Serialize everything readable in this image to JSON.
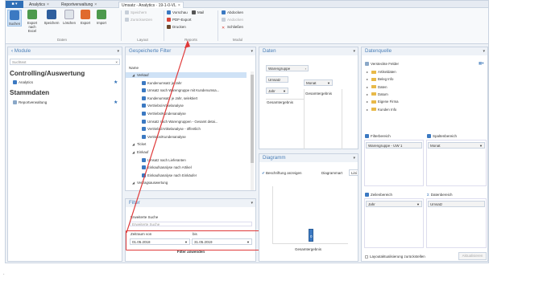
{
  "tabs": [
    {
      "label": "Analytics",
      "close": "×"
    },
    {
      "label": "Reportverwaltung",
      "close": "×"
    },
    {
      "label": "Umsatz - Analytics · 19-1-0-VL",
      "close": "×"
    }
  ],
  "ribbon": {
    "buttons": [
      {
        "label": "Suchen"
      },
      {
        "label": "Export nach Excel"
      },
      {
        "label": "Speichern"
      },
      {
        "label": "Löschen"
      },
      {
        "label": "Export"
      },
      {
        "label": "Import"
      }
    ],
    "daten_group": "Daten",
    "layout_items": [
      "Speichern",
      "Zurücksetzen"
    ],
    "layout_group": "Layout",
    "reports_items": [
      "Vorschau",
      "Mail",
      "PDF-Export",
      "Drucken"
    ],
    "reports_group": "Reports",
    "modul_items": [
      "Abdocken",
      "Andocken",
      "Schließen"
    ],
    "modul_group": "Modul"
  },
  "module_panel": {
    "title": "Module",
    "search_placeholder": "Suchtext",
    "section1": "Controlling/Auswertung",
    "item1": "Analytics",
    "section2": "Stammdaten",
    "item2": "Reportverwaltung"
  },
  "filter_panel": {
    "title": "Gespeicherte Filter",
    "column": "Name",
    "rows": [
      {
        "label": "Verkauf",
        "level": 0,
        "group": true,
        "selected": true
      },
      {
        "label": "Kundenumsatz je Jahr",
        "level": 1
      },
      {
        "label": "Umsatz nach Warengruppe mit Kundenumsa...",
        "level": 1
      },
      {
        "label": "Kundenumsatz je Jahr, selektiert",
        "level": 1
      },
      {
        "label": "Vertriebs/Artikelanalyse",
        "level": 1
      },
      {
        "label": "Vertriebs/Kundenanalyse",
        "level": 1
      },
      {
        "label": "Umsatz nach Warengruppen - Gesamt detai...",
        "level": 1
      },
      {
        "label": "Vertriebs/Artikelanalyse - öffentlich",
        "level": 1
      },
      {
        "label": "Vertriebs/Kundenanalyse",
        "level": 1
      },
      {
        "label": "Ticket",
        "level": 0,
        "group": true
      },
      {
        "label": "Einkauf",
        "level": 0,
        "group": true
      },
      {
        "label": "Umsatz nach Lieferanten",
        "level": 1
      },
      {
        "label": "Einkaufsanalyse nach Artikel",
        "level": 1
      },
      {
        "label": "Einkaufsanalyse nach Einkäufer",
        "level": 1
      },
      {
        "label": "Vertragsauswertung",
        "level": 0,
        "group": true
      }
    ]
  },
  "filter_section": {
    "title": "Filter",
    "advanced": "Erweiterte Suche",
    "collapsed_label": "Erweiterte Suche",
    "from_label": "Zeitraum von",
    "to_label": "bis",
    "from_value": "01.05.2018",
    "to_value": "31.05.2019",
    "apply": "Filter anwenden"
  },
  "daten_panel": {
    "title": "Daten",
    "filter_chip": "Warengruppe",
    "col_field": "Umsatz",
    "row_field": "Jahr",
    "month_chip": "Monat",
    "cell_header": "Gesamtergebnis",
    "row_total": "Gesamtergebnis"
  },
  "diagramm_panel": {
    "title": "Diagramm",
    "checkbox_label": "Beschriftung anzeigen",
    "type_label": "Diagrammart",
    "type_value": "Lini",
    "bar_value": "0",
    "x_label": "Gesamtergebnis"
  },
  "datenquelle_panel": {
    "title": "Datenquelle",
    "tree_title": "Versteckte Felder",
    "tree_items": [
      "Artikeldaten",
      "Beleg Info",
      "Daten",
      "Datum",
      "Eigene Firma",
      "Kunden Info"
    ],
    "filter_area": "Filterbereich",
    "filter_value": "Warengruppe - UW 1",
    "column_area": "Spaltenbereich",
    "column_value": "Monat",
    "row_area": "Zeilenbereich",
    "row_value": "Jahr",
    "data_area": "Datenbereich",
    "data_value": "Umsatz",
    "defer_label": "Layoutaktualisierung zurückstellen",
    "update_btn": "Aktualisieren"
  },
  "colors": {
    "accent": "#2f6fb6",
    "highlight": "#e03a3a",
    "selection": "#cfe2f6"
  }
}
